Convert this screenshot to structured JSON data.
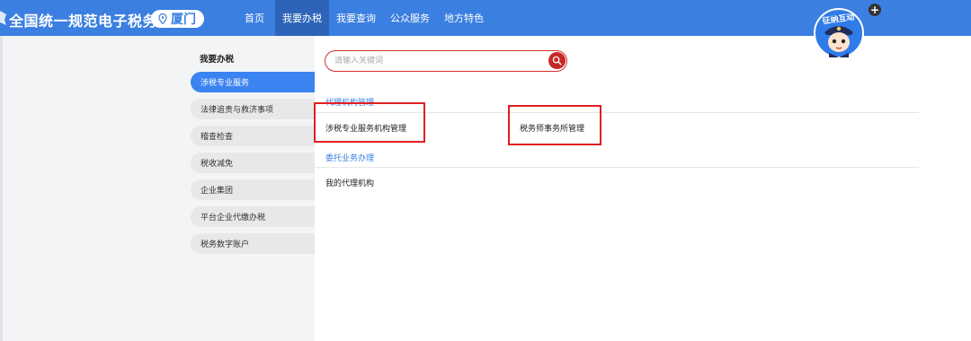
{
  "header": {
    "site_title": "全国统一规范电子税务局",
    "region": "厦门",
    "nav": [
      {
        "label": "首页",
        "active": false
      },
      {
        "label": "我要办税",
        "active": true
      },
      {
        "label": "我要查询",
        "active": false
      },
      {
        "label": "公众服务",
        "active": false
      },
      {
        "label": "地方特色",
        "active": false
      }
    ],
    "avatar_badge": "征纳互动",
    "plus": "+"
  },
  "sidebar": {
    "title": "我要办税",
    "items": [
      {
        "label": "涉税专业服务",
        "active": true
      },
      {
        "label": "法律追责与救济事项",
        "active": false
      },
      {
        "label": "稽查检查",
        "active": false
      },
      {
        "label": "税收减免",
        "active": false
      },
      {
        "label": "企业集团",
        "active": false
      },
      {
        "label": "平台企业代缴办税",
        "active": false
      },
      {
        "label": "税务数字账户",
        "active": false
      }
    ]
  },
  "search": {
    "placeholder": "请输入关键词",
    "value": ""
  },
  "sections": [
    {
      "title": "代理机构管理",
      "links": [
        "涉税专业服务机构管理",
        "税务师事务所管理"
      ]
    },
    {
      "title": "委托业务办理",
      "links": [
        "我的代理机构"
      ]
    }
  ],
  "colors": {
    "header_bg": "#3b7fe0",
    "nav_active_bg": "#2d64b9",
    "sidebar_active": "#3b83f0",
    "search_border": "#d32f2f",
    "highlight_box": "#e02020"
  }
}
